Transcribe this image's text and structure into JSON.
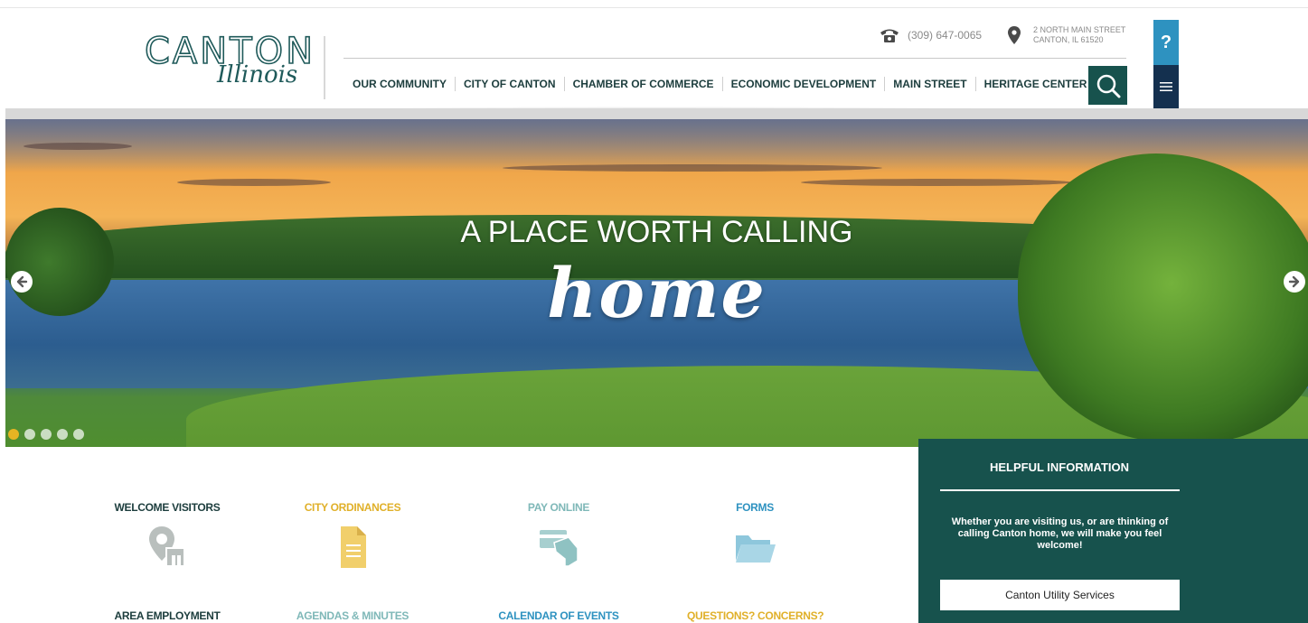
{
  "header": {
    "logo_main": "CANTON",
    "logo_sub": "Illinois",
    "phone": "(309) 647-0065",
    "address_line1": "2 NORTH MAIN STREET",
    "address_line2": "CANTON, IL 61520",
    "help_label": "?"
  },
  "nav": {
    "items": [
      "OUR COMMUNITY",
      "CITY OF CANTON",
      "CHAMBER OF COMMERCE",
      "ECONOMIC DEVELOPMENT",
      "MAIN STREET",
      "HERITAGE CENTER"
    ]
  },
  "hero": {
    "title": "A PLACE WORTH CALLING",
    "script": "home",
    "slide_count": 5,
    "active_slide": 1
  },
  "quick_links": {
    "row1": [
      {
        "label": "WELCOME VISITORS",
        "color": "#1c3d3d",
        "icon": "location-building-icon"
      },
      {
        "label": "CITY ORDINANCES",
        "color": "#e0b029",
        "icon": "document-icon"
      },
      {
        "label": "PAY ONLINE",
        "color": "#7fb8b8",
        "icon": "card-payment-icon"
      },
      {
        "label": "FORMS",
        "color": "#2e92c0",
        "icon": "folder-icon"
      }
    ],
    "row2": [
      {
        "label": "AREA EMPLOYMENT",
        "color": "#1c3d3d"
      },
      {
        "label": "AGENDAS & MINUTES",
        "color": "#7fb8b8"
      },
      {
        "label": "CALENDAR OF EVENTS",
        "color": "#2e92c0"
      },
      {
        "label": "QUESTIONS? CONCERNS?",
        "color": "#e0b029"
      }
    ]
  },
  "helpful": {
    "title": "HELPFUL INFORMATION",
    "text": "Whether you are visiting us, or are thinking of calling Canton home, we will make you feel welcome!",
    "button": "Canton Utility Services"
  },
  "colors": {
    "primary_green": "#17524d",
    "help_blue": "#2e92c0",
    "menu_navy": "#14304f",
    "accent_gold": "#e7b423"
  }
}
